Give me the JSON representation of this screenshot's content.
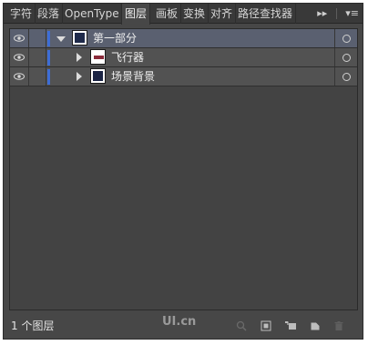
{
  "tabs": [
    {
      "label": "字符"
    },
    {
      "label": "段落"
    },
    {
      "label": "OpenType"
    },
    {
      "label": "图层"
    },
    {
      "label": "画板"
    },
    {
      "label": "变换"
    },
    {
      "label": "对齐"
    },
    {
      "label": "路径查找器"
    }
  ],
  "active_tab": "图层",
  "tabbar": {
    "overflow_glyph": "▸▸",
    "menu_glyph": "▾≡"
  },
  "layers": [
    {
      "name": "第一部分",
      "expanded": true,
      "selected": true,
      "level": 0
    },
    {
      "name": "飞行器",
      "expanded": false,
      "selected": false,
      "level": 1
    },
    {
      "name": "场景背景",
      "expanded": false,
      "selected": false,
      "level": 1
    }
  ],
  "footer": {
    "count_label": "1 个图层",
    "watermark": "UI.cn"
  },
  "colors": {
    "panel_bg": "#474747",
    "layer_color": "#3d6dd6",
    "selected_row": "#5a6070"
  }
}
